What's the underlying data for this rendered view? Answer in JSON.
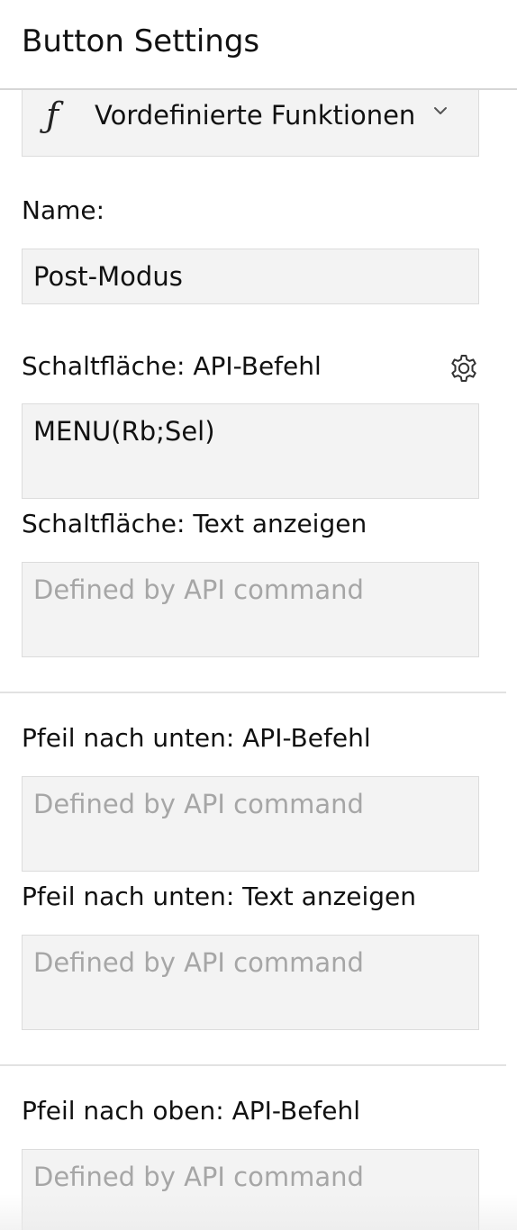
{
  "header": {
    "title": "Button Settings"
  },
  "functions_dropdown": {
    "icon": "function-icon",
    "icon_glyph": "ƒ",
    "label": "Vordefinierte Funktionen"
  },
  "name": {
    "label": "Name:",
    "value": "Post-Modus"
  },
  "button_api": {
    "label": "Schaltfläche: API-Befehl",
    "value": "MENU(Rb;Sel)"
  },
  "button_text": {
    "label": "Schaltfläche: Text anzeigen",
    "placeholder": "Defined by API command"
  },
  "arrow_down_api": {
    "label": "Pfeil nach unten: API-Befehl",
    "placeholder": "Defined by API command"
  },
  "arrow_down_text": {
    "label": "Pfeil nach unten: Text anzeigen",
    "placeholder": "Defined by API command"
  },
  "arrow_up_api": {
    "label": "Pfeil nach oben: API-Befehl",
    "placeholder": "Defined by API command"
  }
}
